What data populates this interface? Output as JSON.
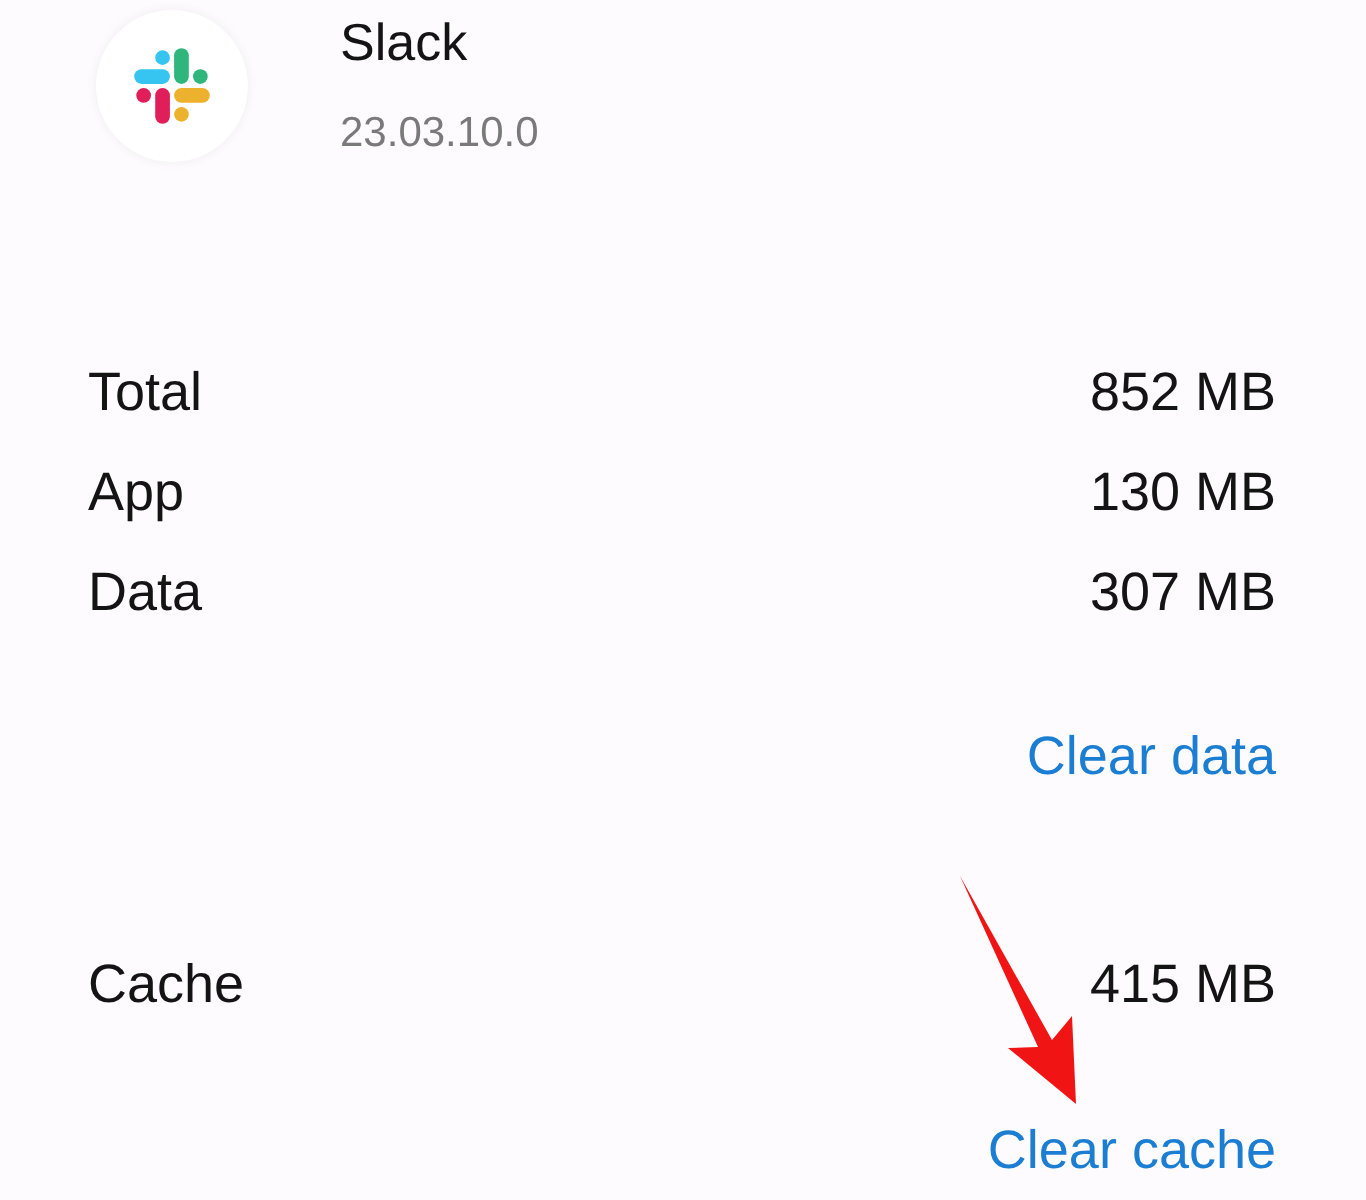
{
  "app": {
    "name": "Slack",
    "version": "23.03.10.0"
  },
  "storage": [
    {
      "label": "Total",
      "value": "852 MB"
    },
    {
      "label": "App",
      "value": "130 MB"
    },
    {
      "label": "Data",
      "value": "307 MB"
    }
  ],
  "clear_data_button": "Clear data",
  "cache": {
    "label": "Cache",
    "value": "415 MB"
  },
  "clear_cache_button": "Clear cache"
}
